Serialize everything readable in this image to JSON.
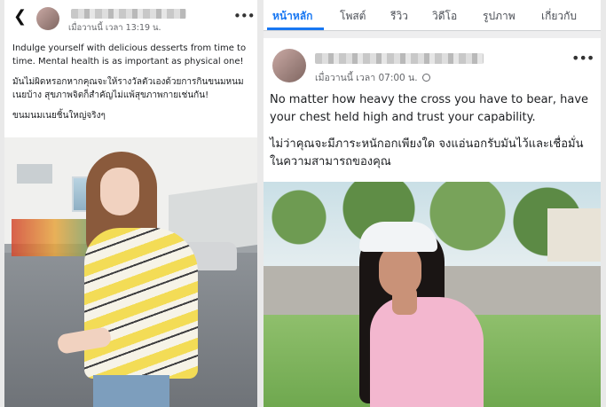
{
  "left_post": {
    "back_icon": "chevron-left-icon",
    "author_name_blurred": "",
    "timestamp": "เมื่อวานนี้ เวลา 13:19 น.",
    "more_icon": "more-dots-icon",
    "text_en": "Indulge yourself with delicious desserts from time to time. Mental health is as important as physical one!",
    "text_th": "มันไม่ผิดหรอกหากคุณจะให้รางวัลตัวเองด้วยการกินขนมหนมเนยบ้าง สุขภาพจิตก็สำคัญไม่แพ้สุขภาพกายเช่นกัน!",
    "text_th2": "ขนมนมเนยชิ้นใหญ่จริงๆ"
  },
  "right_post": {
    "tabs": [
      "หน้าหลัก",
      "โพสต์",
      "รีวิว",
      "วิดีโอ",
      "รูปภาพ",
      "เกี่ยวกับ"
    ],
    "active_tab": "หน้าหลัก",
    "timestamp": "เมื่อวานนี้ เวลา 07:00 น.",
    "privacy_icon": "globe-icon",
    "more_icon": "more-dots-icon",
    "text_en": "No matter how heavy the cross you have to bear, have your chest held high and trust your capability.",
    "text_th": "ไม่ว่าคุณจะมีภาระหนักอกเพียงใด จงแอ่นอกรับมันไว้และเชื่อมั่นในความสามารถของคุณ"
  },
  "colors": {
    "accent": "#1877f2",
    "meta": "#65676b"
  }
}
